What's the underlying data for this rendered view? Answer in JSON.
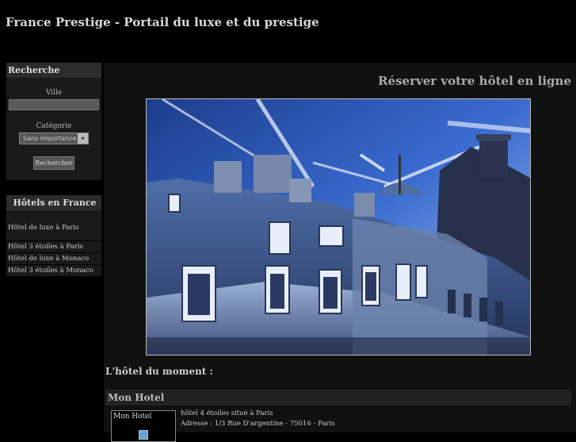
{
  "site": {
    "title": "France Prestige - Portail du luxe et du prestige"
  },
  "search": {
    "heading": "Recherche",
    "city_label": "Ville",
    "city_value": "",
    "category_label": "Catégorie",
    "category_selected": "Sans importance",
    "submit_label": "Rechercher"
  },
  "hotels_nav": {
    "heading": "Hôtels en France",
    "items": [
      {
        "label": "Hôtel de luxe à Paris"
      },
      {
        "label": "Hôtel 3 étoiles à Paris"
      },
      {
        "label": "Hôtel de luxe à Monaco"
      },
      {
        "label": "Hôtel 3 étoiles à Monaco"
      }
    ]
  },
  "main": {
    "title": "Réserver votre hôtel en ligne",
    "moment_heading": "L'hôtel du moment :",
    "featured": {
      "name": "Mon Hotel",
      "thumb_label": "Mon Hotel",
      "desc_line1": "hôtel 4 étoiles situé à Paris",
      "desc_line2": "Adresse : 1/3 Rue D'argentine - 75016 - Paris"
    }
  },
  "colors": {
    "background": "#000000",
    "panel": "#1a1a1a",
    "header": "#2c2c2c"
  }
}
